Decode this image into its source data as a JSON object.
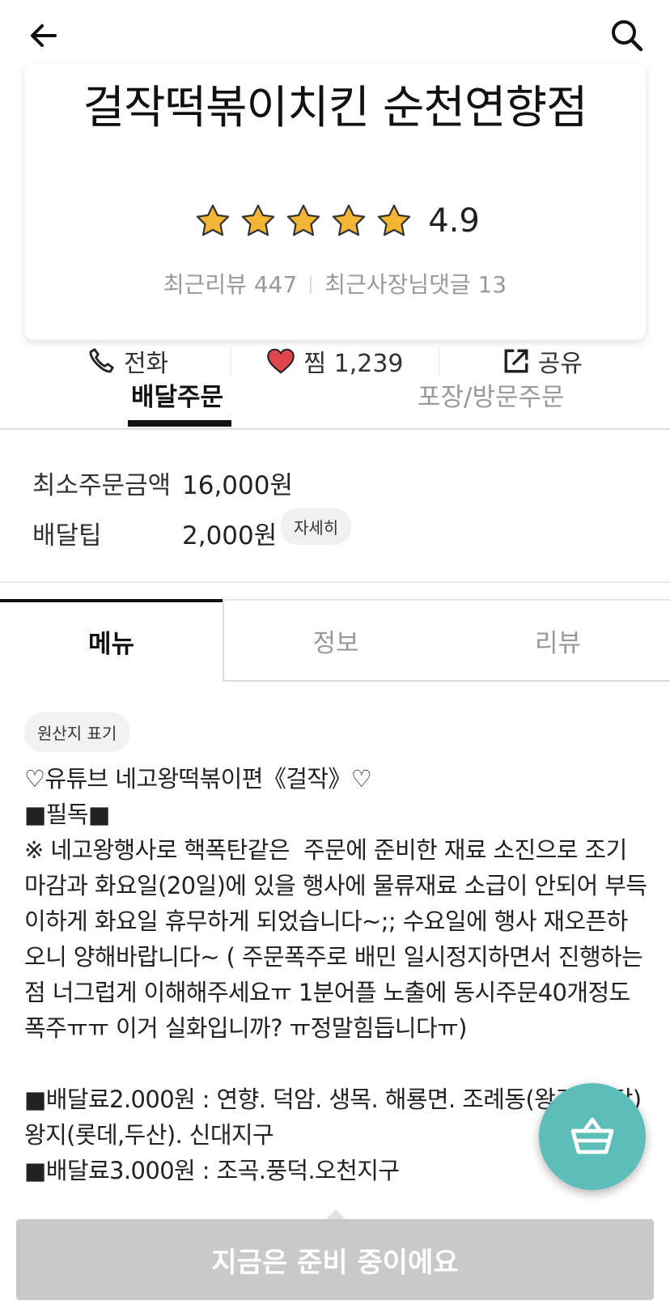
{
  "store": {
    "name": "걸작떡볶이치킨 순천연향점",
    "rating": "4.9",
    "stars": 5,
    "recent_review_label": "최근리뷰 447",
    "recent_reply_label": "최근사장님댓글 13"
  },
  "actions": {
    "call": "전화",
    "favorite": "찜 1,239",
    "share": "공유"
  },
  "order_tabs": {
    "delivery": "배달주문",
    "pickup": "포장/방문주문"
  },
  "order_info": {
    "min_order_label": "최소주문금액",
    "min_order_value": "16,000원",
    "delivery_tip_label": "배달팁",
    "delivery_tip_value": "2,000원",
    "detail_button": "자세히"
  },
  "menu_tabs": {
    "menu": "메뉴",
    "info": "정보",
    "review": "리뷰"
  },
  "origin_chip": "원산지 표기",
  "notice": {
    "line1": "♡유튜브 네고왕떡볶이편《걸작》♡",
    "line2": "■필독■",
    "line3": "※ 네고왕행사로 핵폭탄같은  주문에 준비한 재료 소진으로 조기마감과 화요일(20일)에 있을 행사에 물류재료 소급이 안되어 부득이하게 화요일 휴무하게 되었습니다~;; 수요일에 행사 재오픈하오니 양해바랍니다~ ( 주문폭주로 배민 일시정지하면서 진행하는점 너그럽게 이해해주세요ㅠ 1분어플 노출에 동시주문40개정도 폭주ㅠㅠ 이거 실화입니까? ㅠ정말힘듭니다ㅠ)",
    "line4": "■배달료2.000원 : 연향. 덕암. 생목. 해룡면. 조례동(왕조. 금당)왕지(롯데,두산). 신대지구",
    "line5": "■배달료3.000원 : 조곡.풍덕.오천지구"
  },
  "bottom_button": "지금은 준비 중이에요",
  "colors": {
    "accent_teal": "#5dbdb8",
    "heart_red": "#e0464e",
    "star_gold": "#f2b534",
    "disabled_gray": "#c9c9c9"
  },
  "icons": [
    "back-arrow-icon",
    "search-icon",
    "star-icon",
    "phone-icon",
    "heart-icon",
    "share-icon",
    "basket-icon"
  ]
}
